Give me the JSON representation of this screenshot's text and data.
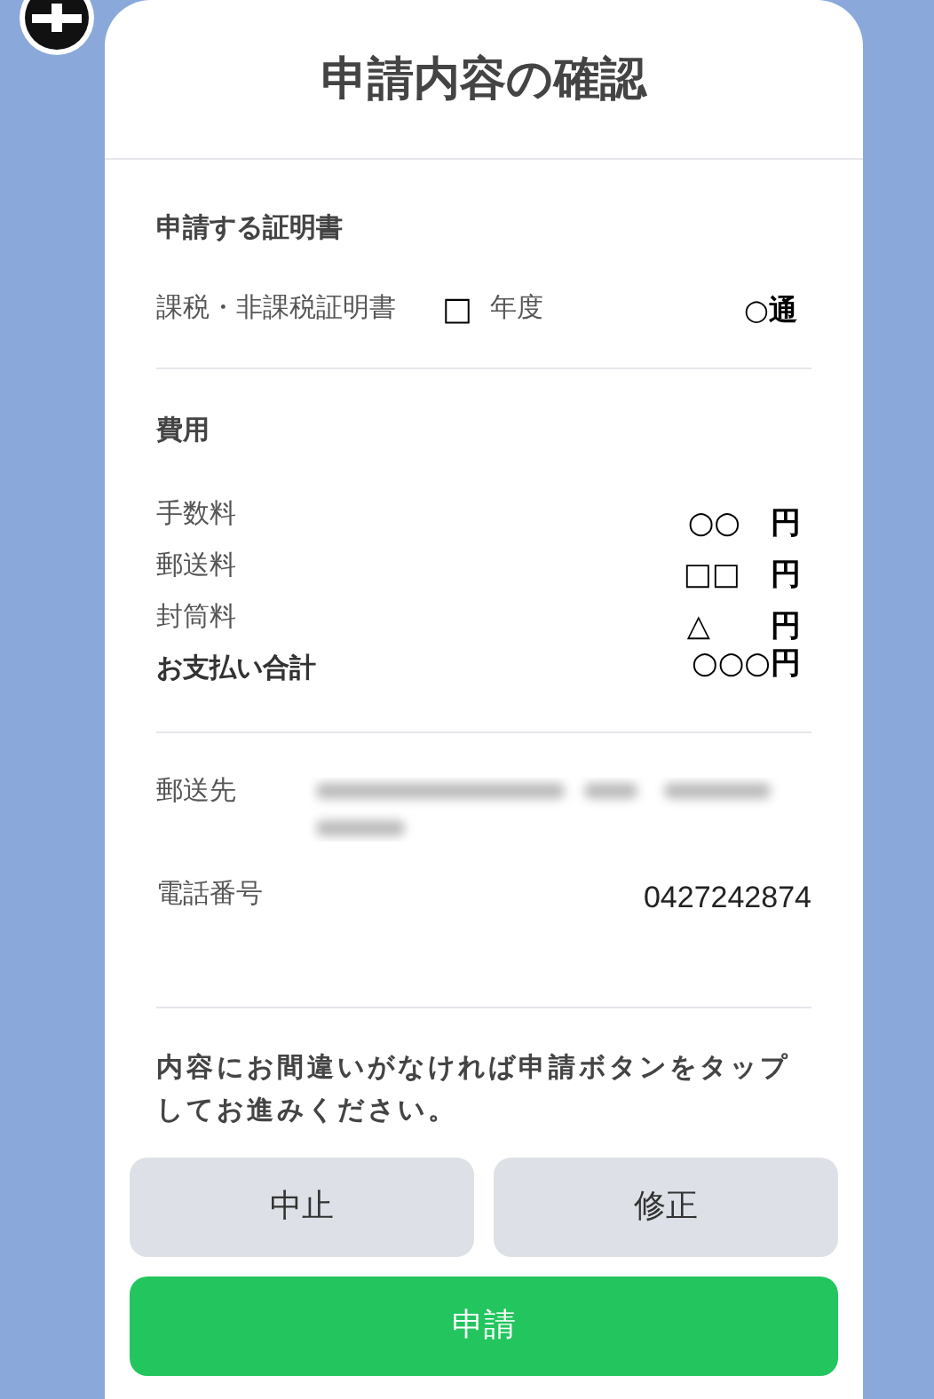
{
  "title": "申請内容の確認",
  "certificate": {
    "heading": "申請する証明書",
    "name": "課税・非課税証明書",
    "year_mark": "□",
    "year_label": "年度",
    "copies": "○通"
  },
  "fees": {
    "heading": "費用",
    "rows": [
      {
        "label": "手数料",
        "amount": "○○　円",
        "total": false
      },
      {
        "label": "郵送料",
        "amount": "□□　円",
        "total": false
      },
      {
        "label": "封筒料",
        "amount": "△　　円",
        "total": false
      },
      {
        "label": "お支払い合計",
        "amount": "○○○円",
        "total": true
      }
    ]
  },
  "contact": [
    {
      "kind": "redacted",
      "label": "郵送先"
    },
    {
      "kind": "text",
      "label": "電話番号",
      "value": "0427242874"
    }
  ],
  "notice": "内容にお間違いがなければ申請ボタンをタップしてお進みください。",
  "buttons": [
    {
      "label": "中止",
      "kind": "secondary"
    },
    {
      "label": "修正",
      "kind": "secondary"
    },
    {
      "label": "申請",
      "kind": "primary"
    }
  ]
}
